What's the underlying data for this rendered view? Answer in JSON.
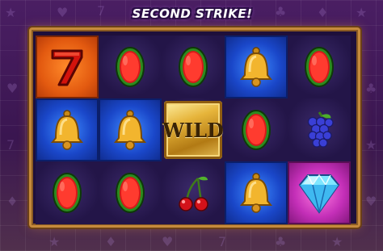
{
  "banner": {
    "title": "SECOND STRIKE!"
  },
  "reels": {
    "rows": [
      [
        {
          "symbol": "seven-icon",
          "bg": "orange"
        },
        {
          "symbol": "watermelon-icon",
          "bg": "dark"
        },
        {
          "symbol": "watermelon-icon",
          "bg": "dark"
        },
        {
          "symbol": "bell-icon",
          "bg": "blue"
        },
        {
          "symbol": "watermelon-icon",
          "bg": "dark"
        }
      ],
      [
        {
          "symbol": "bell-icon",
          "bg": "blue"
        },
        {
          "symbol": "bell-icon",
          "bg": "blue"
        },
        {
          "symbol": "wild-icon",
          "bg": "wild",
          "label": "WILD"
        },
        {
          "symbol": "watermelon-icon",
          "bg": "dark"
        },
        {
          "symbol": "grapes-icon",
          "bg": "dark"
        }
      ],
      [
        {
          "symbol": "watermelon-icon",
          "bg": "dark"
        },
        {
          "symbol": "watermelon-icon",
          "bg": "dark"
        },
        {
          "symbol": "cherries-icon",
          "bg": "dark"
        },
        {
          "symbol": "bell-icon",
          "bg": "blue"
        },
        {
          "symbol": "diamond-icon",
          "bg": "pink"
        }
      ]
    ]
  },
  "colors": {
    "background": "#3a1650",
    "frame_gold": "#c58a3c",
    "blue_tile": "#1a47c9",
    "orange_tile": "#e35a10",
    "pink_tile": "#c42fb8"
  }
}
